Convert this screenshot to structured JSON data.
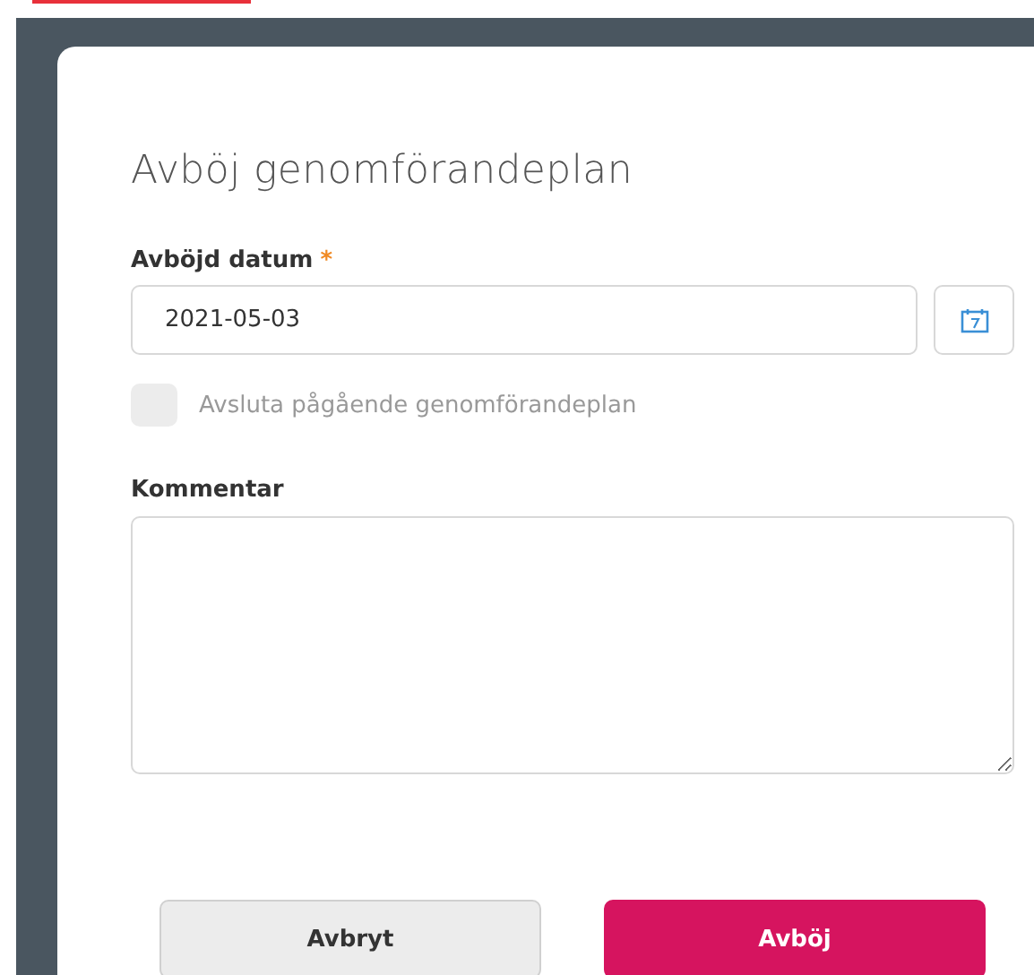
{
  "dialog": {
    "title": "Avböj genomförandeplan",
    "date_field": {
      "label": "Avböjd datum",
      "required_mark": "*",
      "value": "2021-05-03"
    },
    "end_plan_checkbox": {
      "label": "Avsluta pågående genomförandeplan",
      "checked": false,
      "disabled": true
    },
    "comment_field": {
      "label": "Kommentar"
    },
    "buttons": [
      {
        "label": "Avbryt",
        "kind": "secondary"
      },
      {
        "label": "Avböj",
        "kind": "primary"
      }
    ]
  }
}
